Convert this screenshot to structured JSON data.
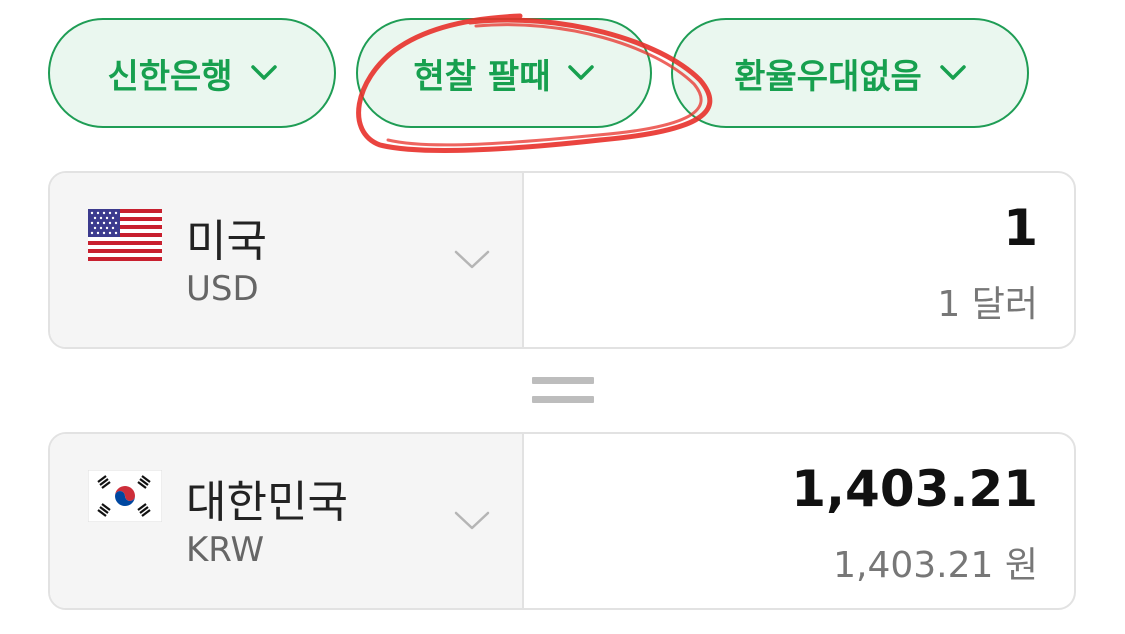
{
  "filters": {
    "bank": "신한은행",
    "type": "현찰 팔때",
    "preference": "환율우대없음"
  },
  "from": {
    "country": "미국",
    "code": "USD",
    "amount": "1",
    "amount_text": "1 달러",
    "flag": "us-flag-icon"
  },
  "to": {
    "country": "대한민국",
    "code": "KRW",
    "amount": "1,403.21",
    "amount_text": "1,403.21 원",
    "flag": "kr-flag-icon"
  },
  "colors": {
    "accent": "#17a04f",
    "pill_bg": "#eaf7ef",
    "annotation": "#e8302a"
  }
}
